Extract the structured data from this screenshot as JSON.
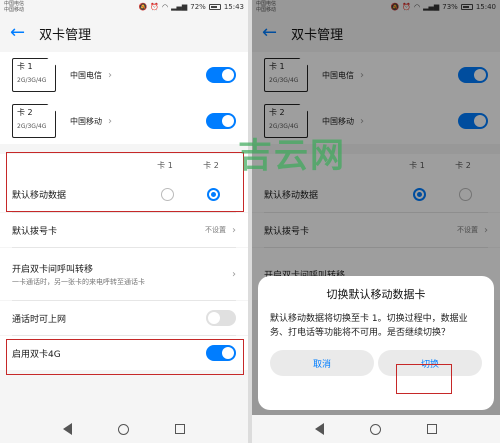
{
  "status": {
    "carrier1": "中国电信",
    "carrier2": "中国移动",
    "left": {
      "battery": "72%",
      "time": "15:43"
    },
    "right": {
      "battery": "73%",
      "time": "15:40"
    }
  },
  "appbar": {
    "title": "双卡管理"
  },
  "sims": [
    {
      "label": "卡 1",
      "bands": "2G/3G/4G",
      "operator": "中国电信"
    },
    {
      "label": "卡 2",
      "bands": "2G/3G/4G",
      "operator": "中国移动"
    }
  ],
  "columns": {
    "card1": "卡 1",
    "card2": "卡 2"
  },
  "settings": {
    "default_data": "默认移动数据",
    "default_dial": "默认拨号卡",
    "default_dial_value": "不设置",
    "call_forward_title": "开启双卡间呼叫转移",
    "call_forward_sub": "一卡通话时，另一张卡的来电呼转至通话卡",
    "internet_in_call": "通话时可上网",
    "enable_4g": "启用双卡4G"
  },
  "dialog": {
    "title": "切换默认移动数据卡",
    "body": "默认移动数据将切换至卡 1。切换过程中，数据业务、打电话等功能将不可用。是否继续切换？",
    "cancel": "取消",
    "confirm": "切换"
  },
  "watermark": "吉云网",
  "colors": {
    "accent": "#007dff",
    "highlight": "#c62828"
  }
}
